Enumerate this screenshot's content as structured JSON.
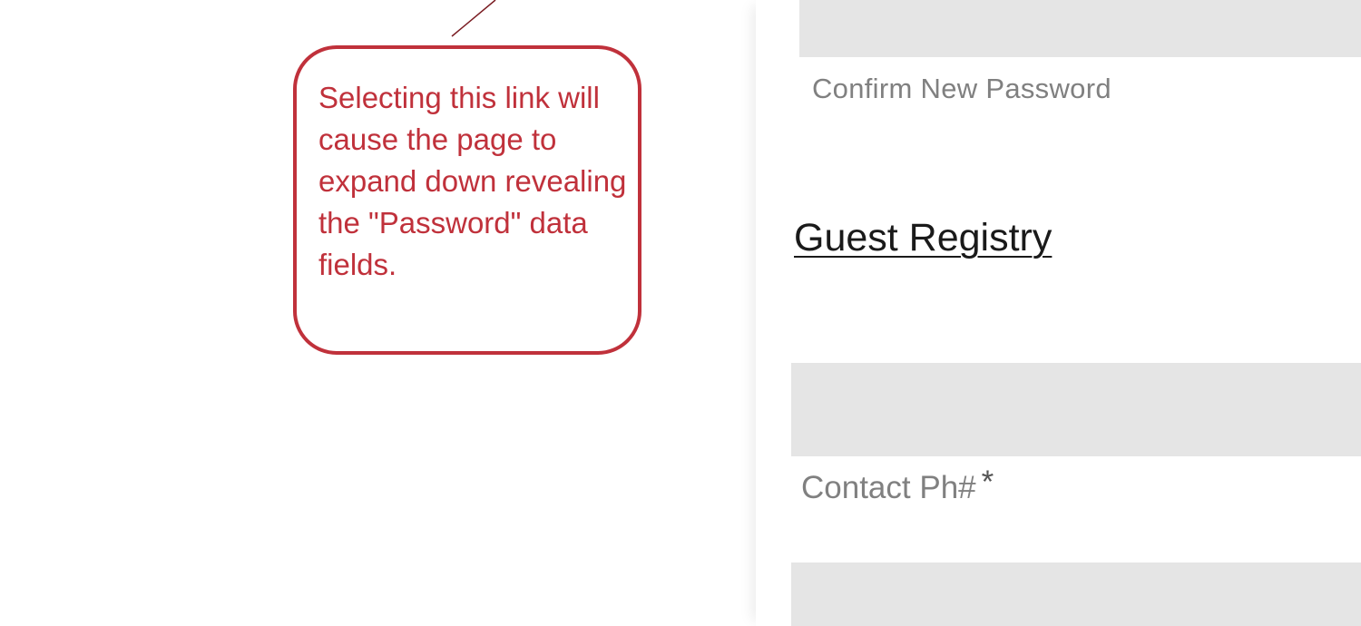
{
  "annotation": {
    "callout_text": "Selecting this link will cause the page to expand down revealing the \"Password\" data fields.",
    "color": "#c0313b"
  },
  "form": {
    "confirm_password": {
      "label": "Confirm New Password",
      "value": ""
    },
    "section_heading": "Guest Registry",
    "contact_phone": {
      "label": "Contact Ph#",
      "required_marker": "*",
      "value": ""
    },
    "input_fill_color": "#e5e5e5",
    "label_color": "#808080"
  }
}
